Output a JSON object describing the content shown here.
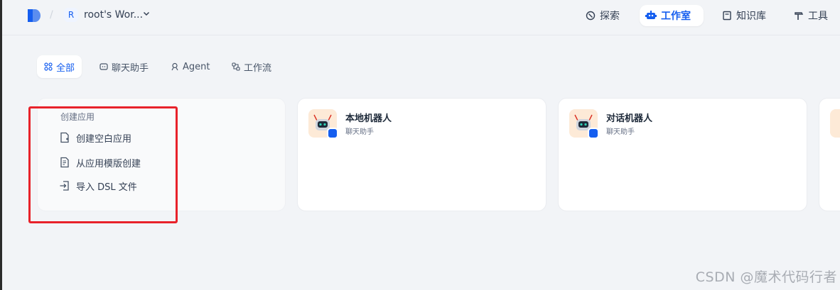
{
  "header": {
    "workspace_initial": "R",
    "workspace_name": "root's Wor...",
    "separator": "/",
    "nav": [
      {
        "label": "探索",
        "icon": "compass-icon"
      },
      {
        "label": "工作室",
        "icon": "robot-icon",
        "active": true
      },
      {
        "label": "知识库",
        "icon": "book-icon"
      },
      {
        "label": "工具",
        "icon": "hammer-icon"
      }
    ]
  },
  "tabs": [
    {
      "label": "全部",
      "icon": "grid-icon",
      "active": true
    },
    {
      "label": "聊天助手",
      "icon": "chat-icon"
    },
    {
      "label": "Agent",
      "icon": "agent-icon"
    },
    {
      "label": "工作流",
      "icon": "workflow-icon"
    }
  ],
  "create_card": {
    "title": "创建应用",
    "items": [
      {
        "label": "创建空白应用",
        "icon": "file-plus-icon"
      },
      {
        "label": "从应用模版创建",
        "icon": "file-template-icon"
      },
      {
        "label": "导入 DSL 文件",
        "icon": "import-icon"
      }
    ]
  },
  "apps": [
    {
      "name": "本地机器人",
      "type": "聊天助手"
    },
    {
      "name": "对话机器人",
      "type": "聊天助手"
    }
  ],
  "watermark": "CSDN @魔术代码行者",
  "colors": {
    "accent": "#155eef",
    "background": "#f2f4f7",
    "highlight": "#e8222a",
    "app_icon_bg": "#fdead7"
  }
}
